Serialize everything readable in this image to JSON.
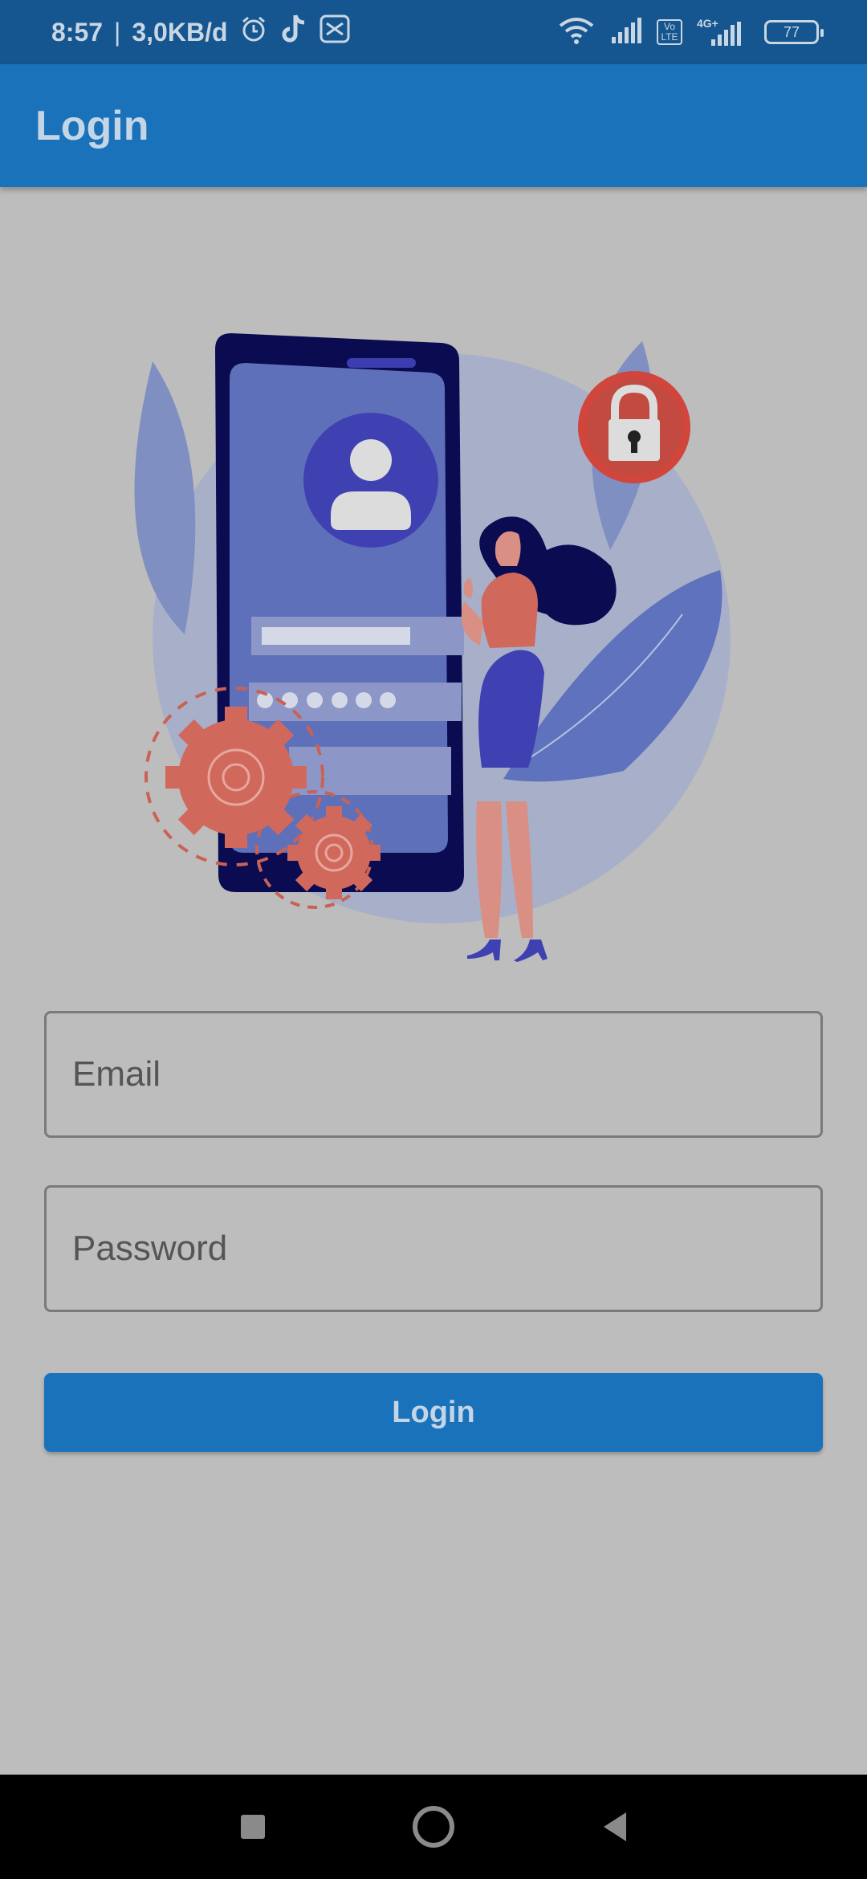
{
  "status_bar": {
    "time": "8:57",
    "separator": "|",
    "speed": "3,0KB/d",
    "network_type": "4G+",
    "volte": "Vo LTE",
    "battery": "77"
  },
  "app_bar": {
    "title": "Login"
  },
  "form": {
    "email_placeholder": "Email",
    "password_placeholder": "Password",
    "login_label": "Login"
  },
  "colors": {
    "app_bar": "#1a72bb",
    "status_bar": "#155690",
    "background": "#bdbdbd",
    "accent_red": "#d0695c"
  }
}
